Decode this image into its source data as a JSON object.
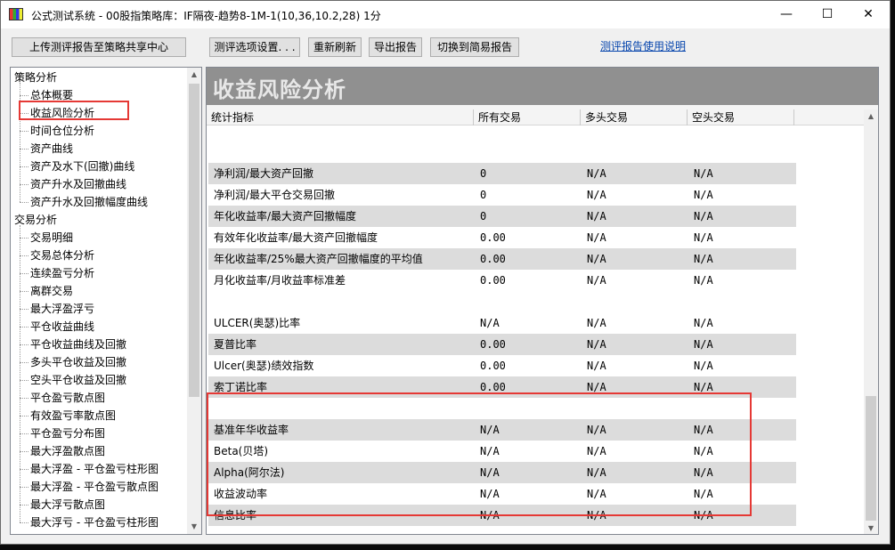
{
  "window": {
    "title": "公式测试系统 - 00股指策略库：IF隔夜-趋势8-1M-1(10,36,10.2,28) 1分",
    "controls": [
      "—",
      "☐",
      "✕"
    ]
  },
  "toolbar": {
    "upload": "上传测评报告至策略共享中心",
    "options": "测评选项设置. . .",
    "refresh": "重新刷新",
    "export": "导出报告",
    "switch": "切换到简易报告",
    "help_link": "测评报告使用说明"
  },
  "sidebar": {
    "groups": [
      {
        "label": "策略分析",
        "items": [
          "总体概要",
          "收益风险分析",
          "时间仓位分析",
          "资产曲线",
          "资产及水下(回撤)曲线",
          "资产升水及回撤曲线",
          "资产升水及回撤幅度曲线"
        ]
      },
      {
        "label": "交易分析",
        "items": [
          "交易明细",
          "交易总体分析",
          "连续盈亏分析",
          "离群交易",
          "最大浮盈浮亏",
          "平仓收益曲线",
          "平仓收益曲线及回撤",
          "多头平仓收益及回撤",
          "空头平仓收益及回撤",
          "平仓盈亏散点图",
          "有效盈亏率散点图",
          "平仓盈亏分布图",
          "最大浮盈散点图",
          "最大浮盈 - 平仓盈亏柱形图",
          "最大浮盈 - 平仓盈亏散点图",
          "最大浮亏散点图",
          "最大浮亏 - 平仓盈亏柱形图"
        ]
      }
    ],
    "selected": "收益风险分析"
  },
  "main": {
    "banner": "收益风险分析",
    "columns": [
      "统计指标",
      "所有交易",
      "多头交易",
      "空头交易"
    ],
    "rows": [
      {
        "label": "",
        "all": "",
        "long": "",
        "short": ""
      },
      {
        "label": "净利润/最大资产回撤",
        "all": "0",
        "long": "N/A",
        "short": "N/A"
      },
      {
        "label": "净利润/最大平仓交易回撤",
        "all": "0",
        "long": "N/A",
        "short": "N/A"
      },
      {
        "label": "年化收益率/最大资产回撤幅度",
        "all": "0",
        "long": "N/A",
        "short": "N/A"
      },
      {
        "label": "有效年化收益率/最大资产回撤幅度",
        "all": "0.00",
        "long": "N/A",
        "short": "N/A"
      },
      {
        "label": "年化收益率/25%最大资产回撤幅度的平均值",
        "all": "0.00",
        "long": "N/A",
        "short": "N/A"
      },
      {
        "label": "月化收益率/月收益率标准差",
        "all": "0.00",
        "long": "N/A",
        "short": "N/A"
      },
      {
        "label": "",
        "all": "",
        "long": "",
        "short": ""
      },
      {
        "label": "ULCER(奥瑟)比率",
        "all": "N/A",
        "long": "N/A",
        "short": "N/A"
      },
      {
        "label": "夏普比率",
        "all": "0.00",
        "long": "N/A",
        "short": "N/A"
      },
      {
        "label": "Ulcer(奥瑟)绩效指数",
        "all": "0.00",
        "long": "N/A",
        "short": "N/A"
      },
      {
        "label": "索丁诺比率",
        "all": "0.00",
        "long": "N/A",
        "short": "N/A"
      },
      {
        "label": "",
        "all": "",
        "long": "",
        "short": ""
      },
      {
        "label": "基准年华收益率",
        "all": "N/A",
        "long": "N/A",
        "short": "N/A"
      },
      {
        "label": "Beta(贝塔)",
        "all": "N/A",
        "long": "N/A",
        "short": "N/A"
      },
      {
        "label": "Alpha(阿尔法)",
        "all": "N/A",
        "long": "N/A",
        "short": "N/A"
      },
      {
        "label": "收益波动率",
        "all": "N/A",
        "long": "N/A",
        "short": "N/A"
      },
      {
        "label": "信息比率",
        "all": "N/A",
        "long": "N/A",
        "short": "N/A"
      }
    ]
  },
  "colors": {
    "banner_bg": "#909090",
    "row_shade": "#dcdcdc",
    "highlight": "#e53935",
    "link": "#0645ad"
  }
}
